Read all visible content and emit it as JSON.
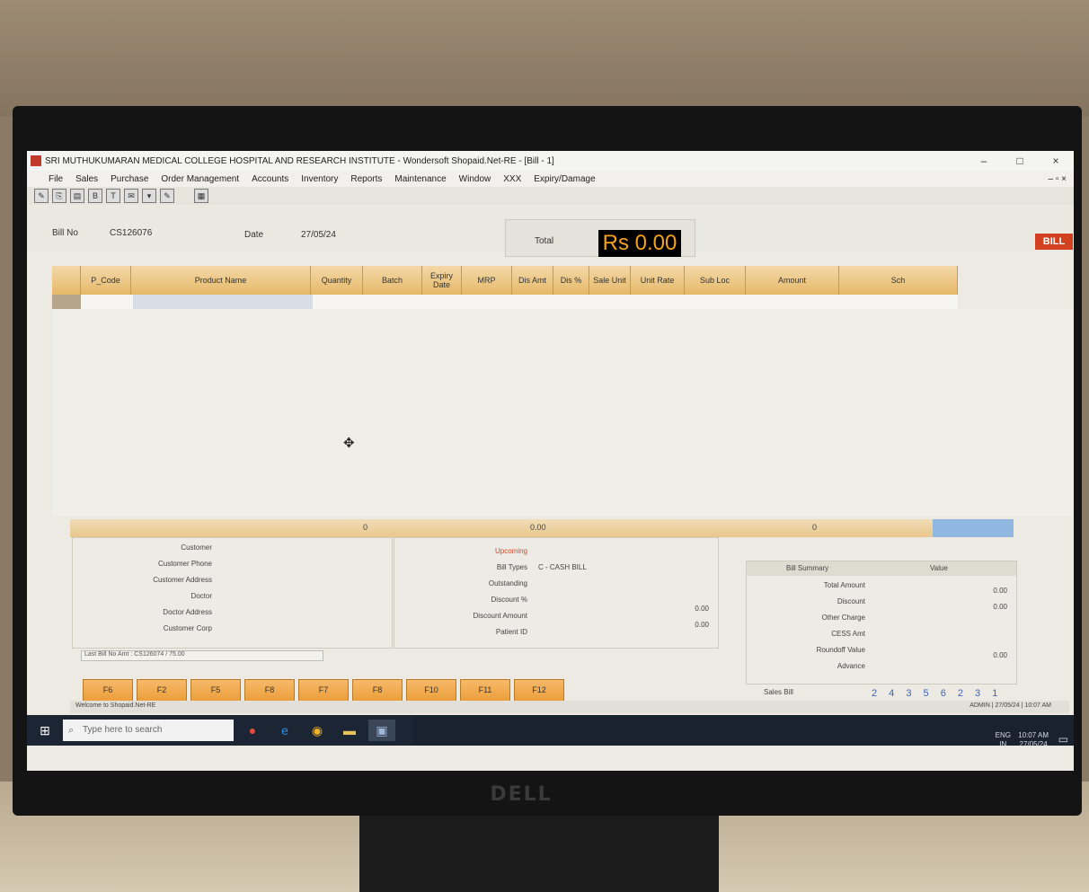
{
  "window": {
    "title": "SRI MUTHUKUMARAN MEDICAL COLLEGE HOSPITAL AND RESEARCH INSTITUTE - Wondersoft Shopaid.Net-RE - [Bill - 1]",
    "minimize": "–",
    "maximize": "□",
    "close": "×"
  },
  "menu": {
    "items": [
      "File",
      "Sales",
      "Purchase",
      "Order Management",
      "Accounts",
      "Inventory",
      "Reports",
      "Maintenance",
      "Window",
      "XXX",
      "Expiry/Damage"
    ],
    "mdi_controls": "– ▫ ×"
  },
  "toolbar": {
    "buttons": [
      "✎",
      "⎘",
      "▤",
      "B",
      "T",
      "✉",
      "▾",
      "✎",
      "▦"
    ]
  },
  "bill_header": {
    "bill_no_label": "Bill No",
    "bill_no_value": "CS126076",
    "date_label": "Date",
    "date_value": "27/05/24",
    "total_label": "Total",
    "total_value": "Rs 0.00",
    "bill_tag": "BILL"
  },
  "grid": {
    "columns": [
      "P_Code",
      "Product Name",
      "Quantity",
      "Batch",
      "Expiry Date",
      "MRP",
      "Dis Amt",
      "Dis %",
      "Sale Unit",
      "Unit Rate",
      "Sub Loc",
      "Amount",
      "Sch"
    ]
  },
  "totals_bar": {
    "qty_total": "0",
    "amount_total": "0.00",
    "sch_total": "0"
  },
  "customer_panel": {
    "labels": [
      "Customer",
      "Customer Phone",
      "Customer Address",
      "Doctor",
      "Doctor Address",
      "Customer Corp"
    ]
  },
  "discount_panel": {
    "upcoming_label": "Upcoming",
    "bill_types_label": "Bill Types",
    "bill_types_value": "C - CASH BILL",
    "outstanding_label": "Outstanding",
    "discount_pct_label": "Discount %",
    "discount_pct_value": "0.00",
    "discount_amount_label": "Discount Amount",
    "discount_amount_value": "0.00",
    "patient_id_label": "Patient ID"
  },
  "bill_summary": {
    "header_label": "Bill Summary",
    "header_value": "Value",
    "rows": [
      {
        "label": "Total Amount",
        "value": "0.00"
      },
      {
        "label": "Discount",
        "value": "0.00"
      },
      {
        "label": "Other Charge",
        "value": ""
      },
      {
        "label": "CESS Amt",
        "value": ""
      },
      {
        "label": "Roundoff Value",
        "value": "0.00"
      },
      {
        "label": "Advance",
        "value": ""
      }
    ]
  },
  "last_bill": "Last Bill No Amt : CS126074 / 75.00",
  "function_keys": [
    "F6",
    "F2",
    "F5",
    "F8",
    "F7",
    "F8",
    "F10",
    "F11",
    "F12"
  ],
  "sales_bill_label": "Sales Bill",
  "page_numbers": "2 4 3 5 6 2 3 1",
  "status": {
    "left": "Welcome to Shopaid.Net-RE",
    "right": "ADMIN | 27/05/24 | 10:07 AM"
  },
  "taskbar": {
    "search_placeholder": "Type here to search",
    "lang": "ENG",
    "lang_sub": "IN",
    "time": "10:07 AM",
    "date": "27/05/24"
  },
  "monitor_brand": "DELL"
}
